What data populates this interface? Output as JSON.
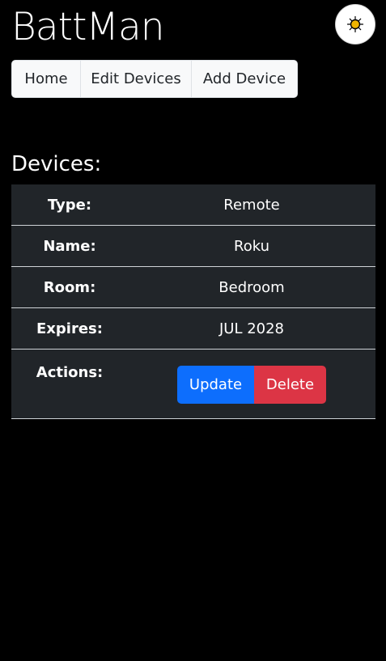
{
  "header": {
    "title": "BattMan",
    "theme_toggle_icon": "sun-icon",
    "theme_icon_color": "#f0b400"
  },
  "nav": {
    "items": [
      {
        "label": "Home"
      },
      {
        "label": "Edit Devices"
      },
      {
        "label": "Add Device"
      }
    ]
  },
  "devices": {
    "heading": "Devices:",
    "fields": {
      "type_label": "Type:",
      "type_value": "Remote",
      "name_label": "Name:",
      "name_value": "Roku",
      "room_label": "Room:",
      "room_value": "Bedroom",
      "expires_label": "Expires:",
      "expires_value": "JUL 2028",
      "actions_label": "Actions:"
    },
    "actions": {
      "update_label": "Update",
      "delete_label": "Delete"
    }
  },
  "colors": {
    "background": "#000000",
    "table_bg": "#212529",
    "primary": "#0d6efd",
    "danger": "#dc3545",
    "nav_bg": "#f8f9fa"
  }
}
